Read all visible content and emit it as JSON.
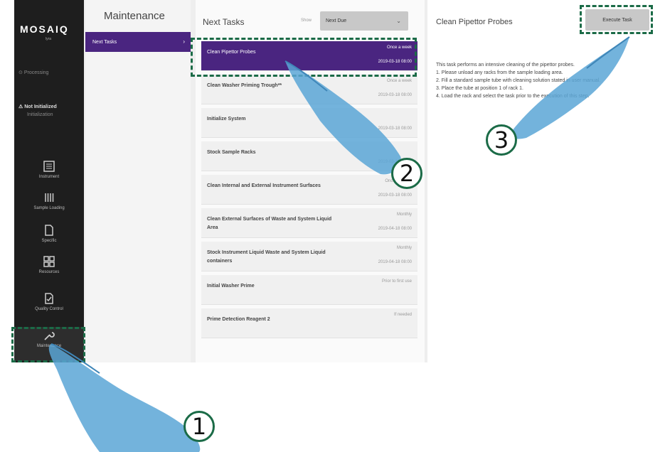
{
  "nav": {
    "logo": "MOSAIQ",
    "logo_sub": "lyra",
    "status_processing": "Processing",
    "status_init": "Not Initialized",
    "status_sub": "Initialization",
    "items": [
      {
        "label": "Instrument",
        "icon": "instrument-icon"
      },
      {
        "label": "Sample Loading",
        "icon": "sample-loading-icon"
      },
      {
        "label": "Specific",
        "icon": "document-icon"
      },
      {
        "label": "Resources",
        "icon": "grid-icon"
      },
      {
        "label": "Quality Control",
        "icon": "quality-control-icon"
      },
      {
        "label": "Maintenance",
        "icon": "wrench-icon"
      }
    ]
  },
  "maintenance": {
    "title": "Maintenance",
    "items": [
      {
        "label": "Next Tasks"
      }
    ]
  },
  "tasks": {
    "title": "Next Tasks",
    "show_label": "Show",
    "select_value": "Next Due",
    "list": [
      {
        "name": "Clean Pipettor Probes",
        "freq": "Once a week",
        "date": "2019-03-18 08:00"
      },
      {
        "name": "Clean Washer Priming Trough**",
        "freq": "Once a week",
        "date": "2019-03-18 08:00"
      },
      {
        "name": "Initialize System",
        "freq": "",
        "date": "2019-03-18 08:00"
      },
      {
        "name": "Stock Sample Racks",
        "freq": "",
        "date": "2019-03-18 08:00"
      },
      {
        "name": "Clean Internal and External Instrument Surfaces",
        "freq": "Once a month",
        "date": "2019-03-18 08:00"
      },
      {
        "name": "Clean External Surfaces of Waste and System Liquid Area",
        "freq": "Monthly",
        "date": "2019-04-18 08:00"
      },
      {
        "name": "Stock Instrument Liquid Waste and System Liquid containers",
        "freq": "Monthly",
        "date": "2019-04-18 08:00"
      },
      {
        "name": "Initial Washer Prime",
        "freq": "Prior to first use",
        "date": ""
      },
      {
        "name": "Prime Detection Reagent 2",
        "freq": "If needed",
        "date": ""
      }
    ]
  },
  "detail": {
    "title": "Clean Pipettor Probes",
    "execute_label": "Execute Task",
    "description": [
      "This task performs an intensive cleaning of the pipettor probes.",
      "1. Please unload any racks from the sample loading area.",
      "2. Fill a standard sample tube with cleaning solution stated in user manual.",
      "3. Place the tube at position 1 of rack 1.",
      "4. Load the rack and select the task prior to the execution of this step."
    ]
  },
  "callouts": [
    "1",
    "2",
    "3"
  ],
  "colors": {
    "accent": "#4a2580",
    "callout": "#1b6b47",
    "nav_bg": "#1e1e1e",
    "glove": "#5aa6d6"
  }
}
